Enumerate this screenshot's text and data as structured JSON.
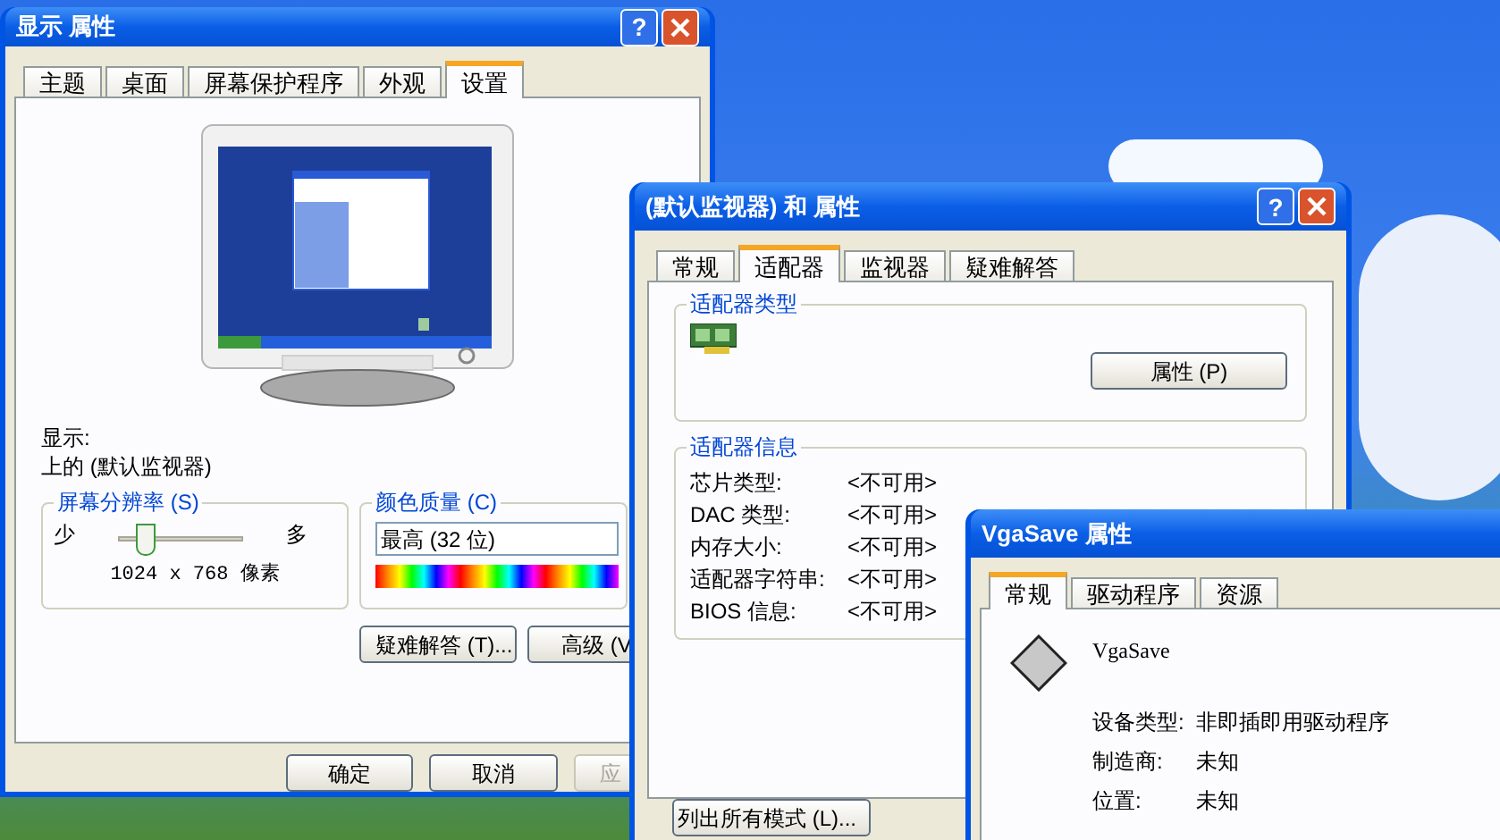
{
  "display_properties": {
    "title": "显示 属性",
    "help_button": "?",
    "tabs": [
      {
        "label": "主题",
        "selected": false
      },
      {
        "label": "桌面",
        "selected": false
      },
      {
        "label": "屏幕保护程序",
        "selected": false
      },
      {
        "label": "外观",
        "selected": false
      },
      {
        "label": "设置",
        "selected": true
      }
    ],
    "display_label": "显示:",
    "display_value": "上的 (默认监视器)",
    "resolution": {
      "title": "屏幕分辨率 (S)",
      "min_label": "少",
      "max_label": "多",
      "level": 0.2,
      "reading": "1024 x 768 像素"
    },
    "color_quality": {
      "title": "颜色质量 (C)",
      "value": "最高 (32 位)"
    },
    "panel_buttons": [
      "疑难解答 (T)...",
      "高级 (V"
    ],
    "buttons": [
      {
        "label": "确定",
        "disabled": false
      },
      {
        "label": "取消",
        "disabled": false
      },
      {
        "label": "应",
        "disabled": true
      }
    ]
  },
  "monitor_properties": {
    "title": "(默认监视器) 和 属性",
    "help_button": "?",
    "tabs": [
      {
        "label": "常规",
        "selected": false
      },
      {
        "label": "适配器",
        "selected": true
      },
      {
        "label": "监视器",
        "selected": false
      },
      {
        "label": "疑难解答",
        "selected": false
      }
    ],
    "adapter_type": {
      "title": "适配器类型",
      "button": "属性 (P)"
    },
    "adapter_info": {
      "title": "适配器信息",
      "rows": [
        {
          "label": "芯片类型:",
          "value": "<不可用>"
        },
        {
          "label": "DAC 类型:",
          "value": "<不可用>"
        },
        {
          "label": "内存大小:",
          "value": "<不可用>"
        },
        {
          "label": "适配器字符串:",
          "value": "<不可用>"
        },
        {
          "label": "BIOS 信息:",
          "value": "<不可用>"
        }
      ]
    },
    "list_modes_button": "列出所有模式 (L)..."
  },
  "vgasave_properties": {
    "title": "VgaSave 属性",
    "tabs": [
      {
        "label": "常规",
        "selected": true
      },
      {
        "label": "驱动程序",
        "selected": false
      },
      {
        "label": "资源",
        "selected": false
      }
    ],
    "device_name": "VgaSave",
    "rows": [
      {
        "label": "设备类型:",
        "value": "非即插即用驱动程序"
      },
      {
        "label": "制造商:",
        "value": "未知"
      },
      {
        "label": "位置:",
        "value": "未知"
      }
    ]
  }
}
